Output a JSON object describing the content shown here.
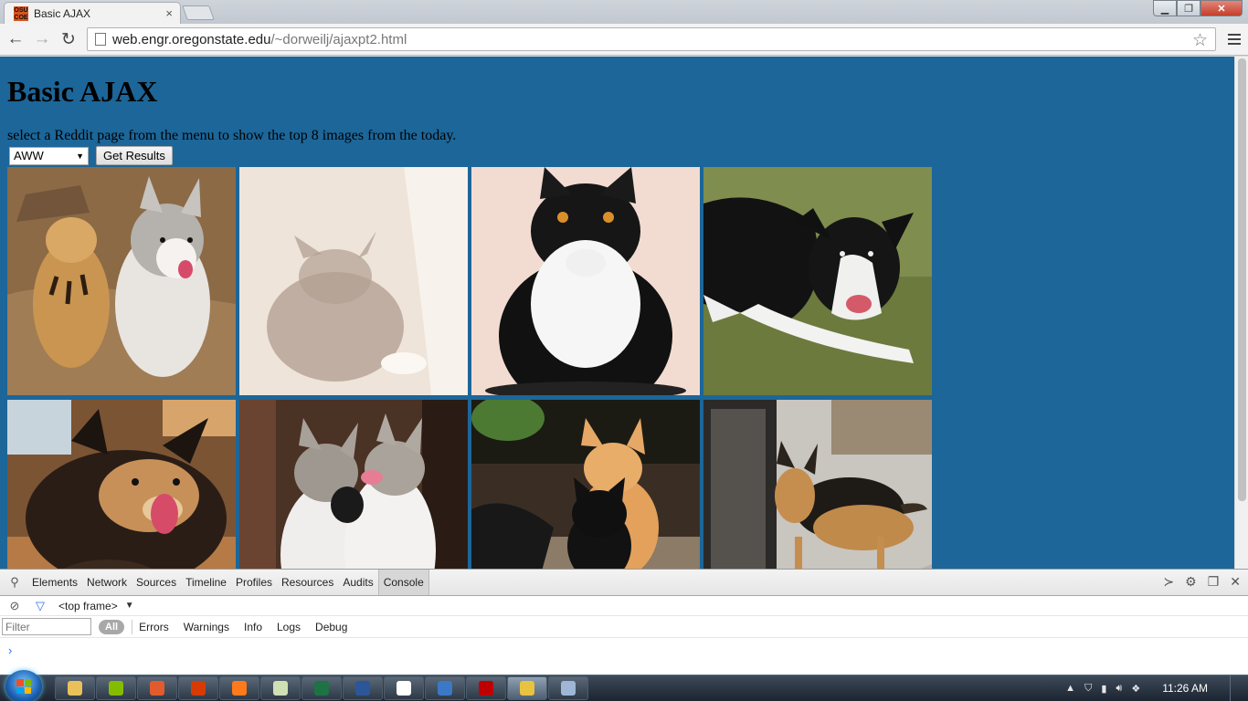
{
  "browser": {
    "tab_title": "Basic AJAX",
    "tab_close": "×",
    "favicon_text": "OSU COE",
    "url_host": "web.engr.oregonstate.edu",
    "url_path": "/~dorweilj/ajaxpt2.html"
  },
  "page": {
    "heading": "Basic AJAX",
    "description": "select a Reddit page from the menu to show the top 8 images from the today.",
    "select_value": "AWW",
    "button_label": "Get Results",
    "images": [
      {
        "subject": "husky-puppy-and-tiger-cub"
      },
      {
        "subject": "cat-behind-curtain"
      },
      {
        "subject": "black-and-white-fluffy-cat"
      },
      {
        "subject": "border-collie-on-grass"
      },
      {
        "subject": "smiling-fluffy-dog"
      },
      {
        "subject": "two-kittens-nuzzling"
      },
      {
        "subject": "orange-kitten-and-black-kitten"
      },
      {
        "subject": "german-shepherd-by-door"
      }
    ]
  },
  "devtools": {
    "tabs": [
      "Elements",
      "Network",
      "Sources",
      "Timeline",
      "Profiles",
      "Resources",
      "Audits",
      "Console"
    ],
    "active_tab": "Console",
    "frame": "<top frame>",
    "filter_placeholder": "Filter",
    "levels_all": "All",
    "levels": [
      "Errors",
      "Warnings",
      "Info",
      "Logs",
      "Debug"
    ],
    "prompt": "›"
  },
  "taskbar": {
    "apps": [
      {
        "name": "file-explorer",
        "color": "#e8c15a"
      },
      {
        "name": "spotify",
        "color": "#84bd00"
      },
      {
        "name": "media-player",
        "color": "#e25b2c"
      },
      {
        "name": "office-app",
        "color": "#d83b01"
      },
      {
        "name": "firefox",
        "color": "#ff7a1a"
      },
      {
        "name": "notepad",
        "color": "#cfe0b4"
      },
      {
        "name": "excel",
        "color": "#1f7244"
      },
      {
        "name": "word",
        "color": "#2b579a"
      },
      {
        "name": "document",
        "color": "#ffffff"
      },
      {
        "name": "browser-app",
        "color": "#3b78c6"
      },
      {
        "name": "filezilla",
        "color": "#bf0000"
      },
      {
        "name": "chrome",
        "color": "#e8c33f"
      },
      {
        "name": "paint",
        "color": "#9fb6d6"
      }
    ],
    "active_app": "chrome",
    "clock": "11:26 AM"
  },
  "colors": {
    "page_background": "#1c6699"
  }
}
